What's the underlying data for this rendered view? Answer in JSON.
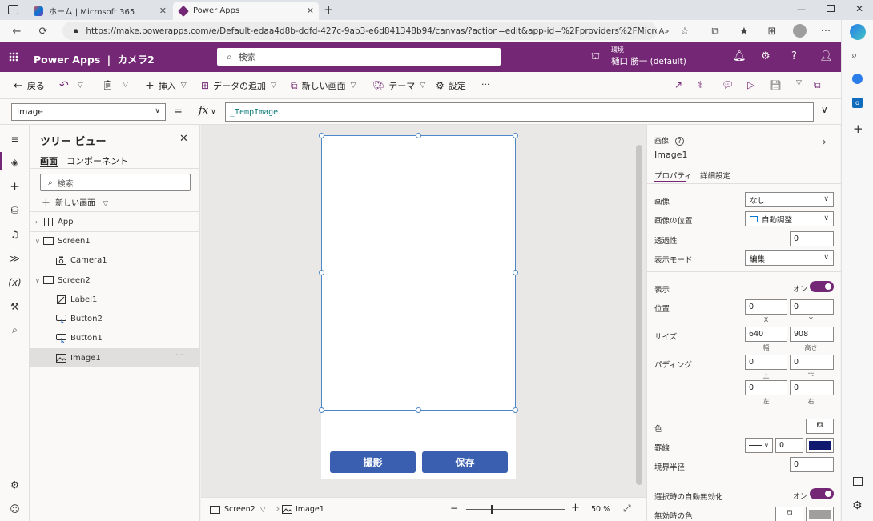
{
  "browser": {
    "tabs": [
      {
        "title": "ホーム | Microsoft 365",
        "active": false
      },
      {
        "title": "Power Apps",
        "active": true
      }
    ],
    "url": "https://make.powerapps.com/e/Default-edaa4d8b-ddfd-427c-9ab3-e6d841348b94/canvas/?action=edit&app-id=%2Fproviders%2FMicrosoft.Power..."
  },
  "header": {
    "product": "Power Apps",
    "separator": "|",
    "app_name": "カメラ2",
    "search_placeholder": "検索",
    "env_label": "環境",
    "env_name": "樋口 勝一 (default)"
  },
  "commands": {
    "back": "戻る",
    "insert": "挿入",
    "add_data": "データの追加",
    "new_screen": "新しい画面",
    "theme": "テーマ",
    "settings": "設定",
    "more": "···"
  },
  "formula": {
    "property": "Image",
    "equals": "=",
    "fx": "fx",
    "value": "_TempImage"
  },
  "tree": {
    "title": "ツリー ビュー",
    "tabs": [
      "画面",
      "コンポーネント"
    ],
    "search_placeholder": "検索",
    "new_screen": "新しい画面",
    "nodes": [
      {
        "label": "App"
      },
      {
        "label": "Screen1"
      },
      {
        "label": "Camera1"
      },
      {
        "label": "Screen2"
      },
      {
        "label": "Label1"
      },
      {
        "label": "Button2"
      },
      {
        "label": "Button1"
      },
      {
        "label": "Image1"
      }
    ],
    "node_more": "···"
  },
  "canvas": {
    "button_shoot": "撮影",
    "button_save": "保存"
  },
  "status": {
    "screen": "Screen2",
    "control": "Image1",
    "zoom": "50",
    "zoom_unit": "%",
    "zoom_minus": "−",
    "zoom_plus": "+"
  },
  "props": {
    "type": "画像",
    "name": "Image1",
    "tabs": [
      "プロパティ",
      "詳細設定"
    ],
    "image_label": "画像",
    "image_value": "なし",
    "position_label": "画像の位置",
    "position_value": "自動調整",
    "transparency_label": "透過性",
    "transparency_value": "0",
    "display_mode_label": "表示モード",
    "display_mode_value": "編集",
    "visible_label": "表示",
    "on": "オン",
    "pos_label": "位置",
    "x": "0",
    "y": "0",
    "x_lbl": "X",
    "y_lbl": "Y",
    "size_label": "サイズ",
    "width": "640",
    "height": "908",
    "w_lbl": "幅",
    "h_lbl": "高さ",
    "padding_label": "パディング",
    "pad_top": "0",
    "pad_bottom": "0",
    "pad_left": "0",
    "pad_right": "0",
    "top_lbl": "上",
    "bottom_lbl": "下",
    "left_lbl": "左",
    "right_lbl": "右",
    "color_label": "色",
    "border_label": "罫線",
    "border_width": "0",
    "border_color": "#0f1a6e",
    "radius_label": "境界半径",
    "radius_value": "0",
    "autodisable_label": "選択時の自動無効化",
    "disabled_color_label": "無効時の色",
    "disabled_color": "#a19f9d"
  },
  "colors": {
    "brand": "#742774",
    "button": "#3a5fb0",
    "selection": "#4d87c7"
  }
}
